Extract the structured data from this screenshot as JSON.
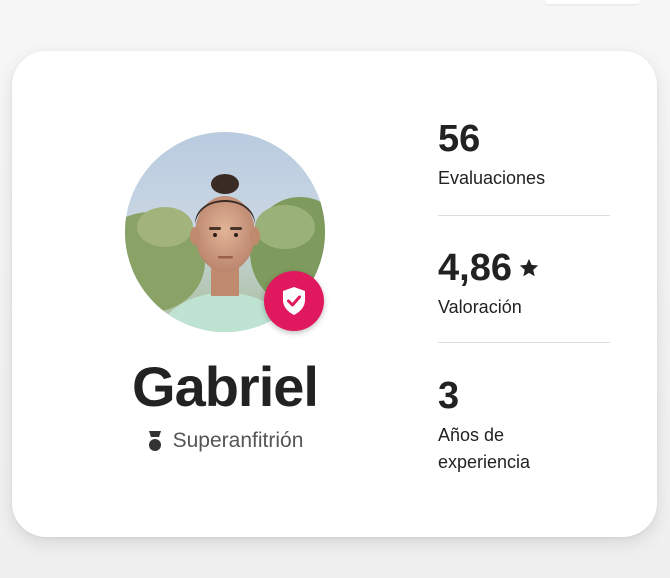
{
  "host": {
    "name": "Gabriel",
    "badge_label": "Superanfitrión",
    "verified_icon": "verified-shield-icon",
    "badge_icon": "superhost-medal-icon"
  },
  "stats": [
    {
      "value": "56",
      "label": "Evaluaciones",
      "icon": null
    },
    {
      "value": "4,86",
      "label": "Valoración",
      "icon": "star-icon"
    },
    {
      "value": "3",
      "label_line1": "Años de",
      "label_line2": "experiencia",
      "icon": null
    }
  ],
  "colors": {
    "accent": "#E0195F",
    "text": "#222222",
    "muted": "#555555",
    "divider": "#DDDDDD"
  }
}
